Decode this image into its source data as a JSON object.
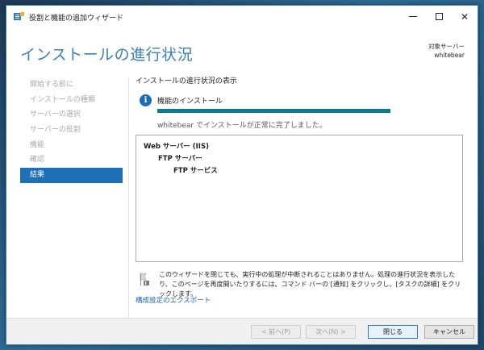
{
  "window": {
    "title": "役割と機能の追加ウィザード",
    "controls": {
      "minimize": "minimize",
      "maximize": "maximize",
      "close": "✕"
    }
  },
  "header": {
    "title": "インストールの進行状況",
    "server_label": "対象サーバー",
    "server_name": "whitebear"
  },
  "nav": {
    "items": [
      {
        "label": "開始する前に",
        "active": false
      },
      {
        "label": "インストールの種類",
        "active": false
      },
      {
        "label": "サーバーの選択",
        "active": false
      },
      {
        "label": "サーバーの役割",
        "active": false
      },
      {
        "label": "機能",
        "active": false
      },
      {
        "label": "確認",
        "active": false
      },
      {
        "label": "結果",
        "active": true
      }
    ]
  },
  "main": {
    "heading": "インストールの進行状況の表示",
    "feature_label": "機能のインストール",
    "progress_percent": 100,
    "status": "whitebear でインストールが正常に完了しました。",
    "results": [
      {
        "label": "Web サーバー (IIS)",
        "level": 0
      },
      {
        "label": "FTP サーバー",
        "level": 1
      },
      {
        "label": "FTP サービス",
        "level": 2
      }
    ],
    "note": "このウィザードを閉じても、実行中の処理が中断されることはありません。処理の進行状況を表示したり、このページを再度開いたりするには、コマンド バーの [通知] をクリックし、[タスクの詳細] をクリックします。",
    "export_link": "構成設定のエクスポート"
  },
  "footer": {
    "prev": "< 前へ(P)",
    "next": "次へ(N) >",
    "close": "閉じる",
    "cancel": "キャンセル"
  },
  "colors": {
    "accent": "#1f6fb7",
    "title_blue": "#3c7fb1",
    "progress": "#0e7a8c",
    "link": "#1d66b0"
  }
}
